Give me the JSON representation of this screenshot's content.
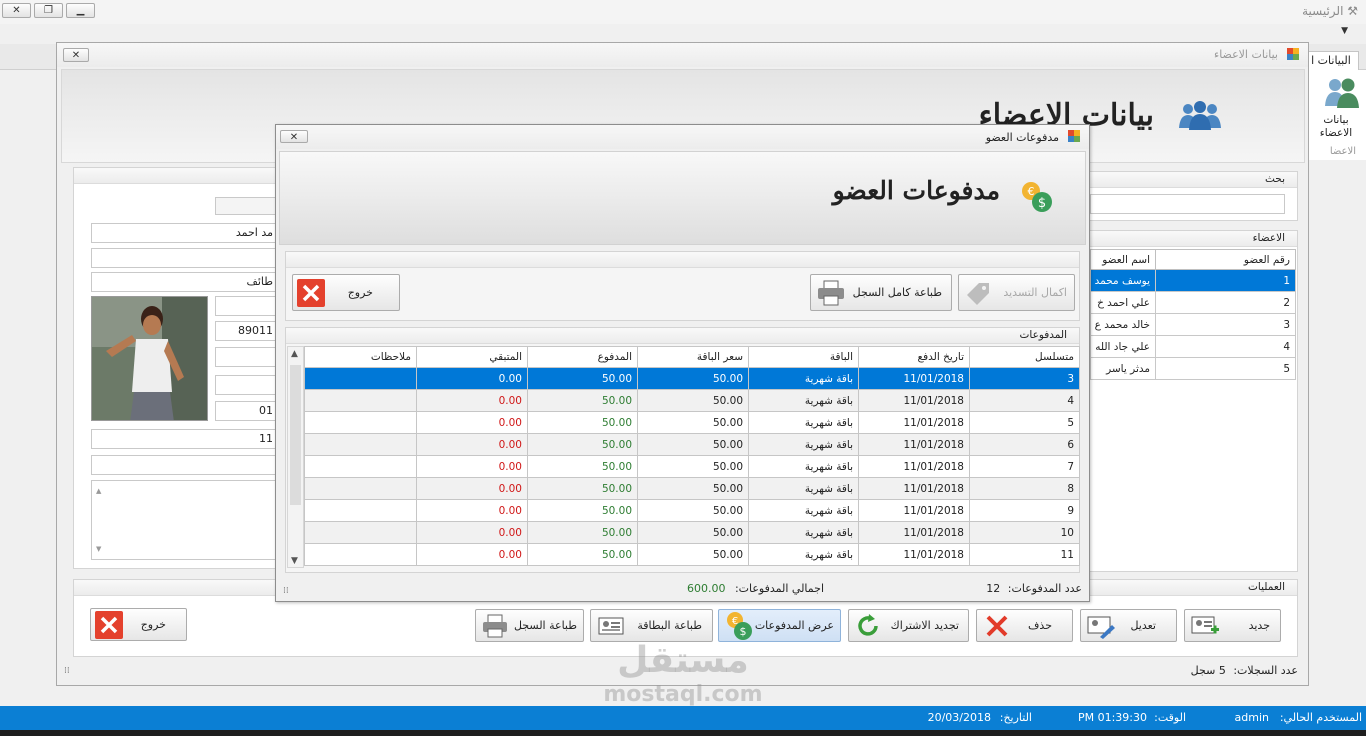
{
  "app": {
    "title": "الرئيسية",
    "qa_arrow": "▼",
    "ribbon_tab": "البيانات ا",
    "ribbon_button": "بيانات الاعضاء",
    "ribbon_group": "الاعضا"
  },
  "members_window": {
    "title": "بيانات الاعضاء",
    "header_title": "بيانات الاعضاء",
    "search_label": "بحث",
    "members_label": "الاعضاء",
    "operations_label": "العمليات",
    "records_count_label": "عدد السجلات:",
    "records_count_value": "5 سجل",
    "fields": {
      "name": "مد احمد",
      "f3": "طائف",
      "phone": "89011",
      "f_date": "01",
      "f_num": "11"
    },
    "table": {
      "headers": [
        "رقم العضو",
        "اسم العضو"
      ],
      "rows": [
        [
          "1",
          "يوسف محمد"
        ],
        [
          "2",
          "علي احمد خ"
        ],
        [
          "3",
          "خالد محمد ع"
        ],
        [
          "4",
          "علي جاد الله"
        ],
        [
          "5",
          "مدثر ياسر"
        ]
      ]
    },
    "buttons": {
      "new": "جديد",
      "edit": "تعديل",
      "delete": "حذف",
      "renew": "تجديد الاشتراك",
      "payments": "عرض المدفوعات",
      "print_card": "طباعة البطاقة",
      "print_record": "طباعة السجل",
      "exit": "خروج"
    }
  },
  "payments_dialog": {
    "title": "مدفوعات العضو",
    "header_title": "مدفوعات العضو",
    "buttons": {
      "complete_payment": "اكمال التسديد",
      "print_full": "طباعة كامل السجل",
      "exit": "خروج"
    },
    "group_label": "المدفوعات",
    "columns": [
      "متسلسل",
      "تاريخ الدفع",
      "الباقة",
      "سعر الباقة",
      "المدفوع",
      "المتبقي",
      "ملاحظات"
    ],
    "rows": [
      [
        "3",
        "11/01/2018",
        "باقة شهرية",
        "50.00",
        "50.00",
        "0.00",
        ""
      ],
      [
        "4",
        "11/01/2018",
        "باقة شهرية",
        "50.00",
        "50.00",
        "0.00",
        ""
      ],
      [
        "5",
        "11/01/2018",
        "باقة شهرية",
        "50.00",
        "50.00",
        "0.00",
        ""
      ],
      [
        "6",
        "11/01/2018",
        "باقة شهرية",
        "50.00",
        "50.00",
        "0.00",
        ""
      ],
      [
        "7",
        "11/01/2018",
        "باقة شهرية",
        "50.00",
        "50.00",
        "0.00",
        ""
      ],
      [
        "8",
        "11/01/2018",
        "باقة شهرية",
        "50.00",
        "50.00",
        "0.00",
        ""
      ],
      [
        "9",
        "11/01/2018",
        "باقة شهرية",
        "50.00",
        "50.00",
        "0.00",
        ""
      ],
      [
        "10",
        "11/01/2018",
        "باقة شهرية",
        "50.00",
        "50.00",
        "0.00",
        ""
      ],
      [
        "11",
        "11/01/2018",
        "باقة شهرية",
        "50.00",
        "50.00",
        "0.00",
        ""
      ]
    ],
    "count_label": "عدد المدفوعات:",
    "count_value": "12",
    "total_label": "اجمالي المدفوعات:",
    "total_value": "600.00"
  },
  "status": {
    "user_label": "المستخدم الحالي:",
    "user_value": "admin",
    "time_label": "الوقت:",
    "time_value": "01:39:30 PM",
    "date_label": "التاريخ:",
    "date_value": "20/03/2018"
  },
  "watermark": {
    "line1": "مستقل",
    "line2": "mostaql.com"
  },
  "colors": {
    "selection": "#0078d7",
    "taskbar": "#0b7fd4",
    "paid": "#2e7d32",
    "remaining": "#d01818"
  }
}
